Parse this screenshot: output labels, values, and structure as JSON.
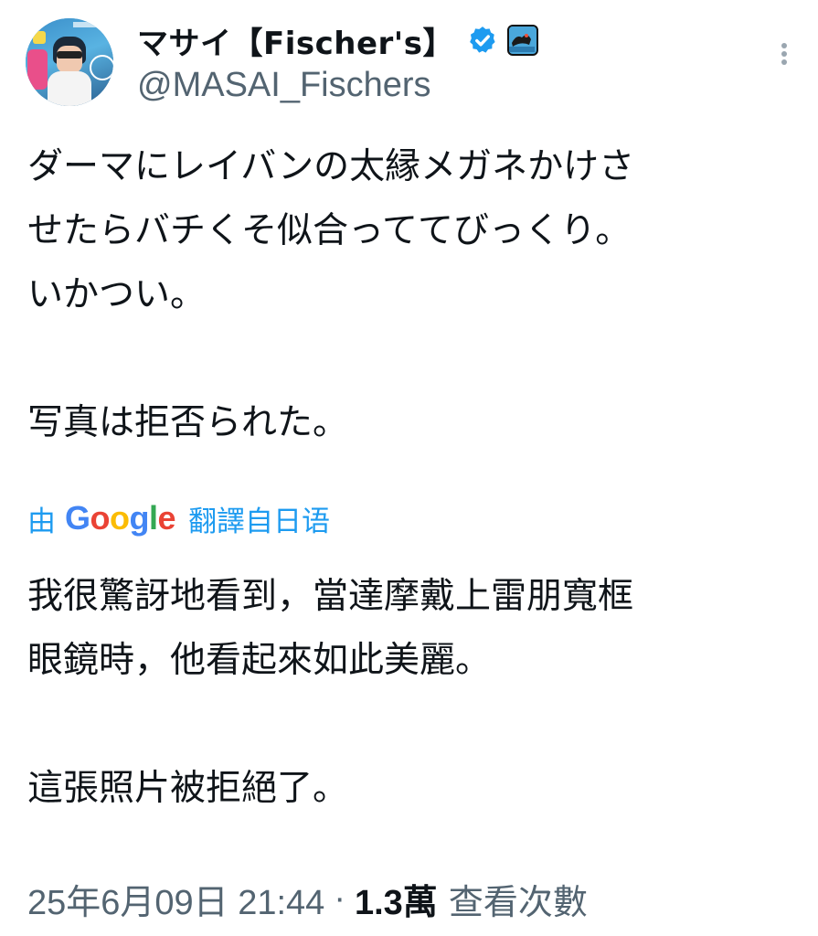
{
  "author": {
    "display_name": "マサイ【Fischer's】",
    "handle": "@MASAI_Fischers",
    "avatar_icon": "profile-avatar",
    "verified_icon": "verified-badge-icon",
    "affiliate_icon": "affiliate-badge-icon",
    "verified_color": "#1d9bf0"
  },
  "more_icon": "more-vertical-icon",
  "tweet": {
    "lines": [
      "ダーマにレイバンの太縁メガネかけさ",
      "せたらバチくそ似合っててびっくり。",
      "いかつい。",
      "写真は拒否られた。"
    ]
  },
  "translation": {
    "prefix": "由",
    "google_label": "Google",
    "suffix": "翻譯自日语",
    "link_color": "#1d9bf0",
    "lines": [
      "我很驚訝地看到，當達摩戴上雷朋寬框",
      "眼鏡時，他看起來如此美麗。",
      "這張照片被拒絕了。"
    ]
  },
  "meta": {
    "timestamp": "25年6月09日 21:44",
    "separator": "·",
    "views_count": "1.3萬",
    "views_label": "查看次數"
  }
}
